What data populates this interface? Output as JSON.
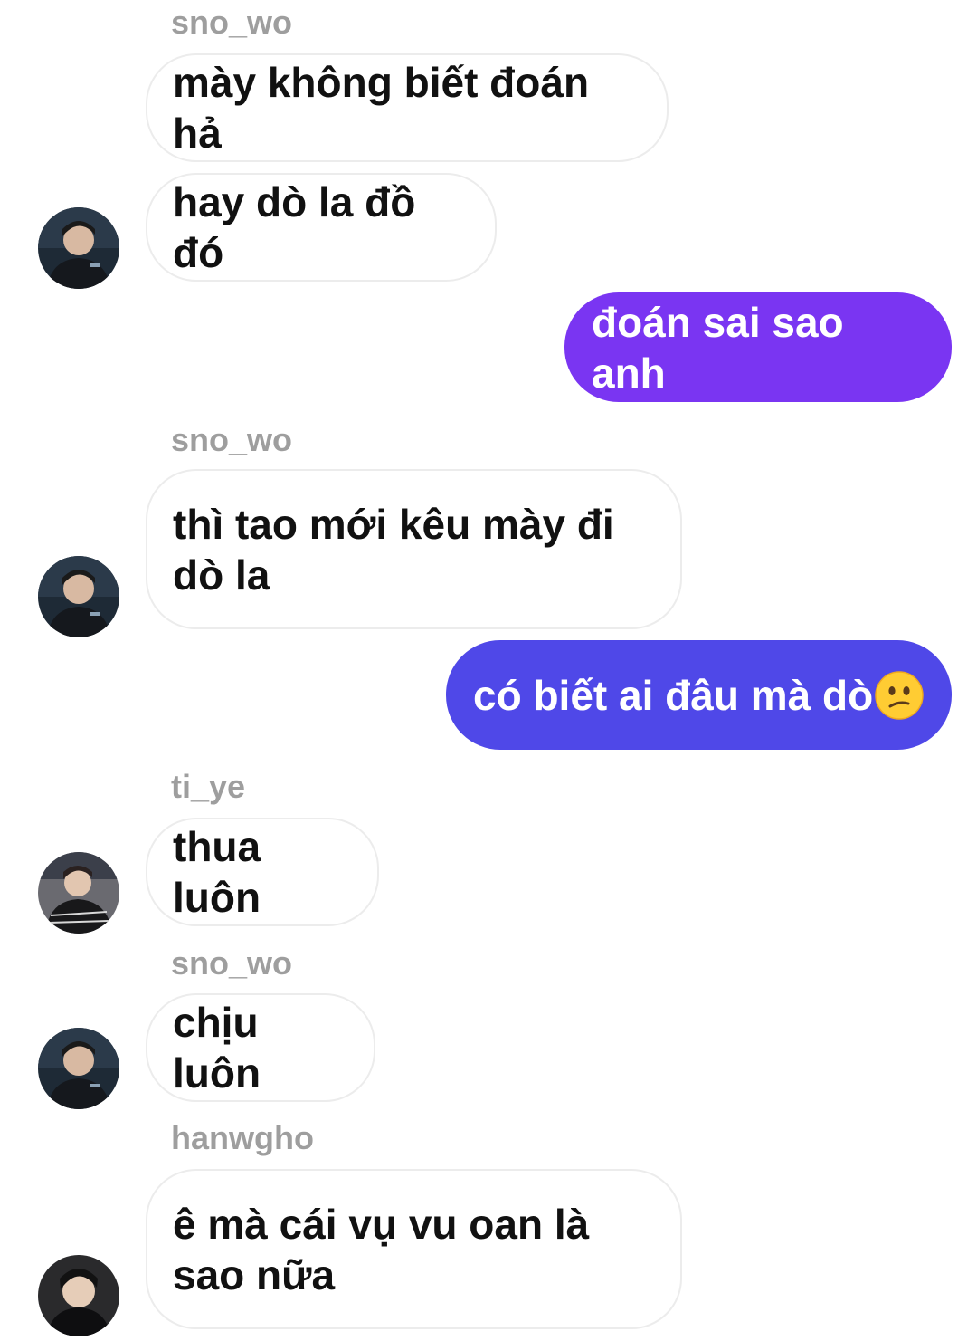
{
  "messages": [
    {
      "sender": "sno_wo",
      "lines": [
        "mày không biết đoán hả"
      ]
    },
    {
      "lines": [
        "hay dò la đồ đó"
      ]
    },
    {
      "self": true,
      "text": "đoán sai sao anh"
    },
    {
      "sender": "sno_wo",
      "lines": [
        "thì tao mới kêu mày đi",
        "dò la"
      ]
    },
    {
      "self": true,
      "text": "có biết ai đâu mà dò",
      "emoji": "confused-face-icon"
    },
    {
      "sender": "ti_ye",
      "lines": [
        "thua luôn"
      ]
    },
    {
      "sender": "sno_wo",
      "lines": [
        "chịu luôn"
      ]
    },
    {
      "sender": "hanwgho",
      "lines": [
        "ê mà cái vụ vu oan là",
        "sao nữa"
      ]
    }
  ],
  "colors": {
    "outgoing_purple": "#7a35f2",
    "outgoing_indigo": "#4f48e8",
    "incoming_border": "#ececec",
    "sender_name": "#9e9e9e"
  }
}
